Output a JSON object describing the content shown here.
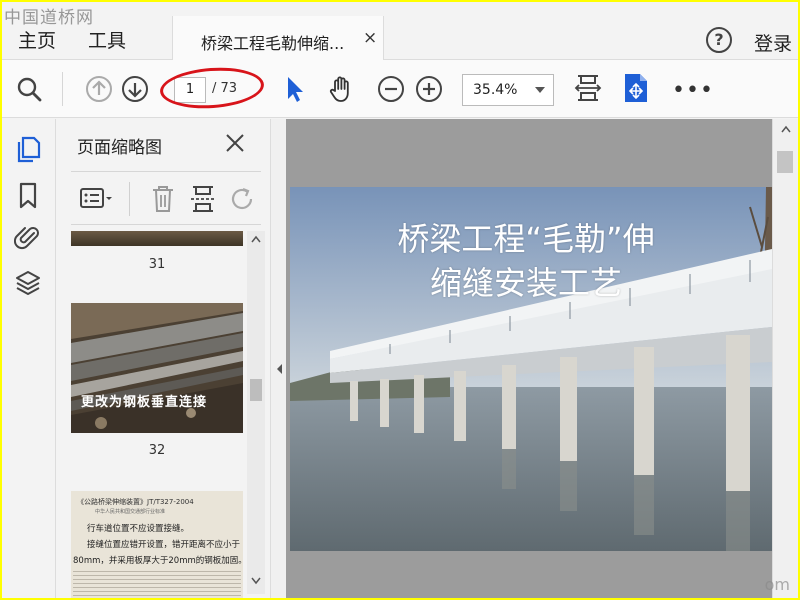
{
  "watermark": {
    "top_left": "中国道桥网",
    "bottom_right": "om"
  },
  "menu": {
    "home": "主页",
    "tools": "工具"
  },
  "tab": {
    "title": "桥梁工程毛勒伸缩...",
    "close": "×"
  },
  "header": {
    "login": "登录"
  },
  "toolbar": {
    "current_page": "1",
    "total_pages": "/ 73",
    "zoom": "35.4%",
    "more": "•••"
  },
  "panel": {
    "title": "页面缩略图",
    "thumbnails": [
      {
        "number": "31"
      },
      {
        "number": "32",
        "caption": "更改为钢板垂直连接"
      },
      {
        "header": "《公路桥梁伸缩装置》JT/T327-2004",
        "sub": "中华人民共和国交通部行业标准",
        "lines": [
          "行车道位置不应设置接缝。",
          "接缝位置应错开设置，错开距离不应小于",
          "80mm，并采用板厚大于20mm的钢板加固。"
        ]
      }
    ]
  },
  "slide": {
    "title_line1": "桥梁工程“毛勒”伸",
    "title_line2": "缩缝安装工艺"
  },
  "colors": {
    "annotation": "#d8141a",
    "cursor_blue": "#1e5fd6",
    "frame": "#ffff00"
  }
}
